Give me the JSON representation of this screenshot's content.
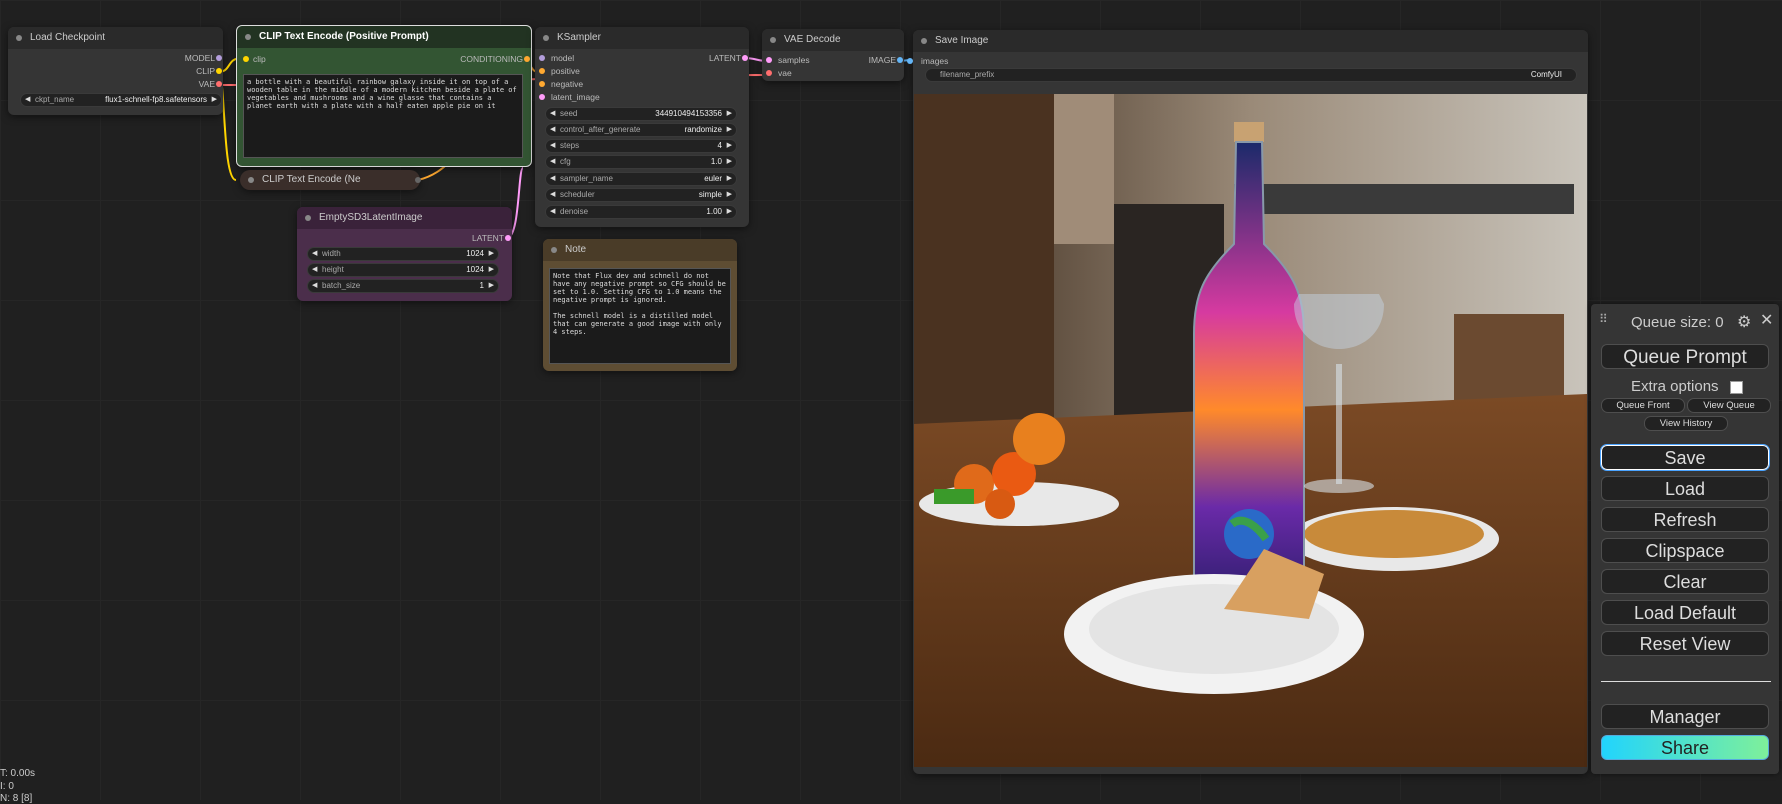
{
  "nodes": {
    "load_checkpoint": {
      "title": "Load Checkpoint",
      "outputs": [
        "MODEL",
        "CLIP",
        "VAE"
      ],
      "ckpt_label": "ckpt_name",
      "ckpt_value": "flux1-schnell-fp8.safetensors"
    },
    "clip_pos": {
      "title": "CLIP Text Encode (Positive Prompt)",
      "input": "clip",
      "output": "CONDITIONING",
      "text": "a bottle with a beautiful rainbow galaxy inside it on top of a wooden table in the middle of a modern kitchen beside a plate of vegetables and mushrooms and a wine glasse that contains a planet earth with a plate with a half eaten apple pie on it"
    },
    "clip_neg": {
      "title": "CLIP Text Encode (Ne"
    },
    "ksampler": {
      "title": "KSampler",
      "inputs": [
        "model",
        "positive",
        "negative",
        "latent_image"
      ],
      "output": "LATENT",
      "widgets": [
        {
          "label": "seed",
          "value": "344910494153356"
        },
        {
          "label": "control_after_generate",
          "value": "randomize"
        },
        {
          "label": "steps",
          "value": "4"
        },
        {
          "label": "cfg",
          "value": "1.0"
        },
        {
          "label": "sampler_name",
          "value": "euler"
        },
        {
          "label": "scheduler",
          "value": "simple"
        },
        {
          "label": "denoise",
          "value": "1.00"
        }
      ]
    },
    "vae_decode": {
      "title": "VAE Decode",
      "inputs": [
        "samples",
        "vae"
      ],
      "output": "IMAGE"
    },
    "save_image": {
      "title": "Save Image",
      "input": "images",
      "prefix_label": "filename_prefix",
      "prefix_value": "ComfyUI"
    },
    "empty_latent": {
      "title": "EmptySD3LatentImage",
      "output": "LATENT",
      "widgets": [
        {
          "label": "width",
          "value": "1024"
        },
        {
          "label": "height",
          "value": "1024"
        },
        {
          "label": "batch_size",
          "value": "1"
        }
      ]
    },
    "note": {
      "title": "Note",
      "text": "Note that Flux dev and schnell do not have any negative prompt so CFG should be set to 1.0. Setting CFG to 1.0 means the negative prompt is ignored.\n\nThe schnell model is a distilled model that can generate a good image with only 4 steps."
    }
  },
  "menu": {
    "queue_size": "Queue size: 0",
    "queue_prompt": "Queue Prompt",
    "extra_options": "Extra options",
    "queue_front": "Queue Front",
    "view_queue": "View Queue",
    "view_history": "View History",
    "save": "Save",
    "load": "Load",
    "refresh": "Refresh",
    "clipspace": "Clipspace",
    "clear": "Clear",
    "load_default": "Load Default",
    "reset_view": "Reset View",
    "manager": "Manager",
    "share": "Share"
  },
  "stats": {
    "line1": "T: 0.00s",
    "line2": "I: 0",
    "line3": "N: 8 [8]"
  },
  "colors": {
    "clip_link": "#ffd500",
    "model_link": "#b39ddb",
    "vae_link": "#ff6e6e",
    "latent_link": "#ff9cf9",
    "conditioning_link": "#ffa931",
    "image_link": "#64b5f6"
  }
}
